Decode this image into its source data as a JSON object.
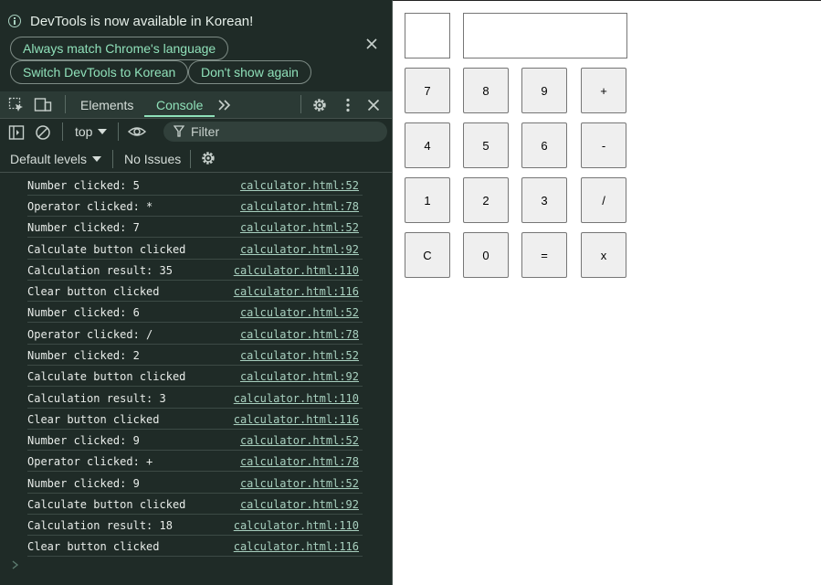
{
  "infobar": {
    "message": "DevTools is now available in Korean!",
    "buttons": [
      "Always match Chrome's language",
      "Switch DevTools to Korean",
      "Don't show again"
    ]
  },
  "toolbar": {
    "tabs": [
      "Elements",
      "Console"
    ],
    "active_tab": "Console",
    "more": ">>"
  },
  "filterbar": {
    "context": "top",
    "filter_placeholder": "Filter"
  },
  "levelsbar": {
    "levels": "Default levels",
    "issues": "No Issues"
  },
  "console": {
    "entries": [
      {
        "message": "Number clicked: 5",
        "source": "calculator.html:52"
      },
      {
        "message": "Operator clicked: *",
        "source": "calculator.html:78"
      },
      {
        "message": "Number clicked: 7",
        "source": "calculator.html:52"
      },
      {
        "message": "Calculate button clicked",
        "source": "calculator.html:92"
      },
      {
        "message": "Calculation result: 35",
        "source": "calculator.html:110"
      },
      {
        "message": "Clear button clicked",
        "source": "calculator.html:116"
      },
      {
        "message": "Number clicked: 6",
        "source": "calculator.html:52"
      },
      {
        "message": "Operator clicked: /",
        "source": "calculator.html:78"
      },
      {
        "message": "Number clicked: 2",
        "source": "calculator.html:52"
      },
      {
        "message": "Calculate button clicked",
        "source": "calculator.html:92"
      },
      {
        "message": "Calculation result: 3",
        "source": "calculator.html:110"
      },
      {
        "message": "Clear button clicked",
        "source": "calculator.html:116"
      },
      {
        "message": "Number clicked: 9",
        "source": "calculator.html:52"
      },
      {
        "message": "Operator clicked: +",
        "source": "calculator.html:78"
      },
      {
        "message": "Number clicked: 9",
        "source": "calculator.html:52"
      },
      {
        "message": "Calculate button clicked",
        "source": "calculator.html:92"
      },
      {
        "message": "Calculation result: 18",
        "source": "calculator.html:110"
      },
      {
        "message": "Clear button clicked",
        "source": "calculator.html:116"
      }
    ],
    "prompt": ">"
  },
  "calculator": {
    "display_value": "",
    "keys": [
      [
        "7",
        "8",
        "9",
        "+"
      ],
      [
        "4",
        "5",
        "6",
        "-"
      ],
      [
        "1",
        "2",
        "3",
        "/"
      ],
      [
        "C",
        "0",
        "=",
        "x"
      ]
    ]
  },
  "colors": {
    "devtools_bg": "#1f2b27",
    "accent": "#8fe0b9",
    "link": "#a8d0bf",
    "key_bg": "#efefef"
  }
}
